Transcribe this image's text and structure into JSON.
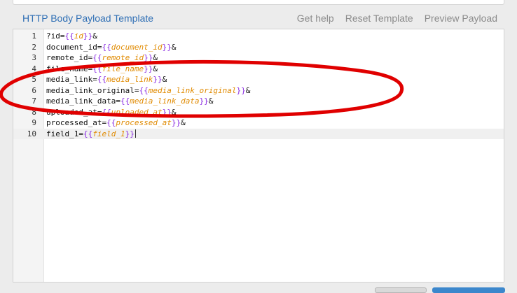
{
  "header": {
    "title": "HTTP Body Payload Template",
    "actions": {
      "get_help": "Get help",
      "reset_template": "Reset Template",
      "preview_payload": "Preview Payload"
    }
  },
  "editor": {
    "active_line": 10,
    "lines": [
      {
        "number": "1",
        "prefix": "?id=",
        "open": "{{",
        "var": "id",
        "close": "}}",
        "suffix": "&"
      },
      {
        "number": "2",
        "prefix": "document_id=",
        "open": "{{",
        "var": "document_id",
        "close": "}}",
        "suffix": "&"
      },
      {
        "number": "3",
        "prefix": "remote_id=",
        "open": "{{",
        "var": "remote_id",
        "close": "}}",
        "suffix": "&"
      },
      {
        "number": "4",
        "prefix": "file_name=",
        "open": "{{",
        "var": "file_name",
        "close": "}}",
        "suffix": "&"
      },
      {
        "number": "5",
        "prefix": "media_link=",
        "open": "{{",
        "var": "media_link",
        "close": "}}",
        "suffix": "&"
      },
      {
        "number": "6",
        "prefix": "media_link_original=",
        "open": "{{",
        "var": "media_link_original",
        "close": "}}",
        "suffix": "&"
      },
      {
        "number": "7",
        "prefix": "media_link_data=",
        "open": "{{",
        "var": "media_link_data",
        "close": "}}",
        "suffix": "&"
      },
      {
        "number": "8",
        "prefix": "uploaded_at=",
        "open": "{{",
        "var": "uploaded_at",
        "close": "}}",
        "suffix": "&"
      },
      {
        "number": "9",
        "prefix": "processed_at=",
        "open": "{{",
        "var": "processed_at",
        "close": "}}",
        "suffix": "&"
      },
      {
        "number": "10",
        "prefix": "field_1=",
        "open": "{{",
        "var": "field_1",
        "close": "}}",
        "suffix": ""
      }
    ]
  },
  "colors": {
    "title": "#2f6fb5",
    "brace": "#8a2be2",
    "variable": "#e08a00",
    "annotation": "#e00000"
  }
}
